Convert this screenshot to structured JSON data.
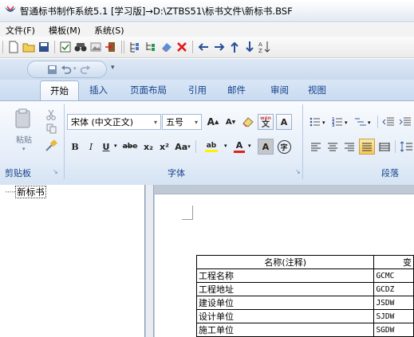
{
  "window": {
    "title": "智通标书制作系统5.1 [学习版]→D:\\ZTBS51\\标书文件\\新标书.BSF"
  },
  "menubar": {
    "items": [
      {
        "label": "文件(F)"
      },
      {
        "label": "模板(M)"
      },
      {
        "label": "系统(S)"
      }
    ]
  },
  "ribbon": {
    "tabs": [
      {
        "label": "开始"
      },
      {
        "label": "插入"
      },
      {
        "label": "页面布局"
      },
      {
        "label": "引用"
      },
      {
        "label": "邮件"
      },
      {
        "label": "审阅"
      },
      {
        "label": "视图"
      }
    ],
    "clipboard": {
      "group_label": "剪贴板",
      "paste_label": "粘贴"
    },
    "font": {
      "group_label": "字体",
      "font_name": "宋体 (中文正文)",
      "font_size": "五号",
      "bold": "B",
      "italic": "I",
      "underline": "U",
      "strike": "abe",
      "subscript": "x₂",
      "superscript": "x²",
      "change_case": "Aa",
      "grow": "A",
      "shrink": "A",
      "phonetic": "wén",
      "phonetic_char": "文",
      "char_border": "A",
      "highlight": "ab",
      "font_color": "A",
      "char_shading": "A",
      "enclose": "字"
    },
    "paragraph": {
      "group_label": "段落"
    }
  },
  "tree": {
    "nodes": [
      {
        "label": "新标书"
      }
    ]
  },
  "document": {
    "table_header": "名称(注释)",
    "header_col2_partial": "变",
    "rows": [
      {
        "name": "工程名称",
        "code": "GCMC"
      },
      {
        "name": "工程地址",
        "code": "GCDZ"
      },
      {
        "name": "建设单位",
        "code": "JSDW"
      },
      {
        "name": "设计单位",
        "code": "SJDW"
      },
      {
        "name": "施工单位",
        "code": "SGDW"
      }
    ]
  }
}
